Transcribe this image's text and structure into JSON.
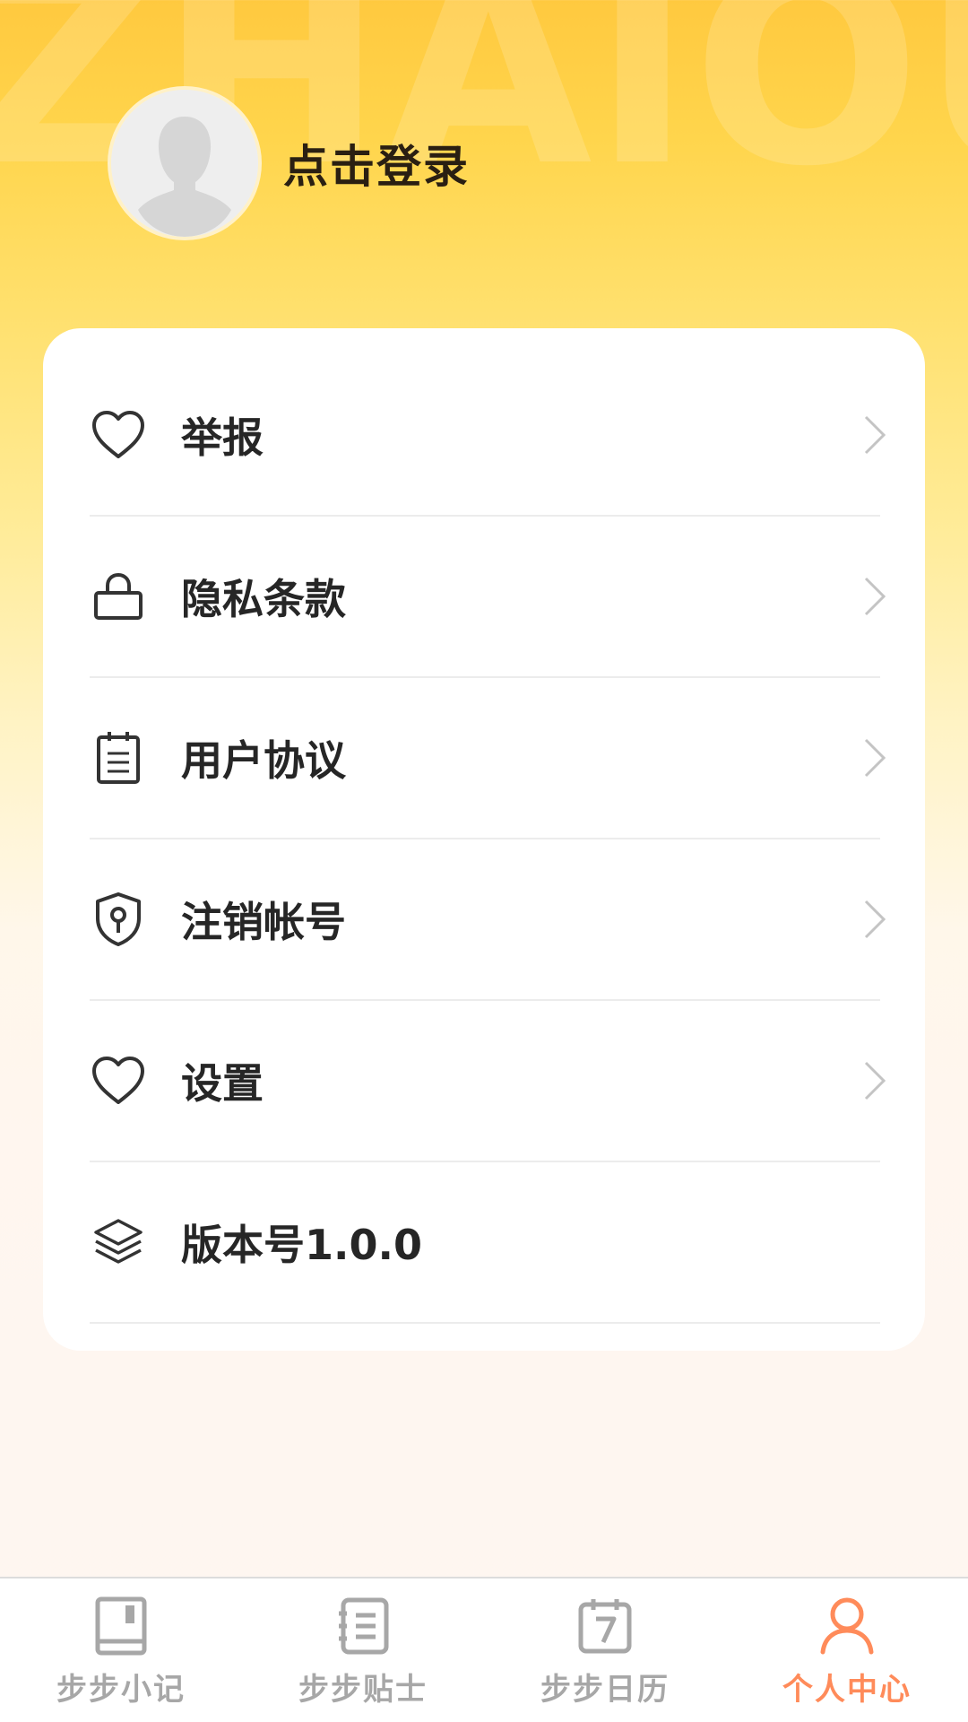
{
  "profile": {
    "login_label": "点击登录"
  },
  "menu": {
    "items": [
      {
        "label": "举报",
        "icon": "heart-icon"
      },
      {
        "label": "隐私条款",
        "icon": "lock-icon"
      },
      {
        "label": "用户协议",
        "icon": "notepad-icon"
      },
      {
        "label": "注销帐号",
        "icon": "shield-key-icon"
      },
      {
        "label": "设置",
        "icon": "heart-icon"
      },
      {
        "label": "版本号1.0.0",
        "icon": "layers-icon"
      }
    ]
  },
  "tabbar": {
    "tabs": [
      {
        "label": "步步小记",
        "icon": "book-icon",
        "active": false
      },
      {
        "label": "步步贴士",
        "icon": "notebook-list-icon",
        "active": false
      },
      {
        "label": "步步日历",
        "icon": "calendar-icon",
        "active": false
      },
      {
        "label": "个人中心",
        "icon": "person-icon",
        "active": true
      }
    ]
  },
  "colors": {
    "accent_active_tab": "#ff8b5a",
    "inactive_tab": "#a7a7a7",
    "gradient_top": "#ffc93f",
    "card_bg": "#ffffff"
  }
}
